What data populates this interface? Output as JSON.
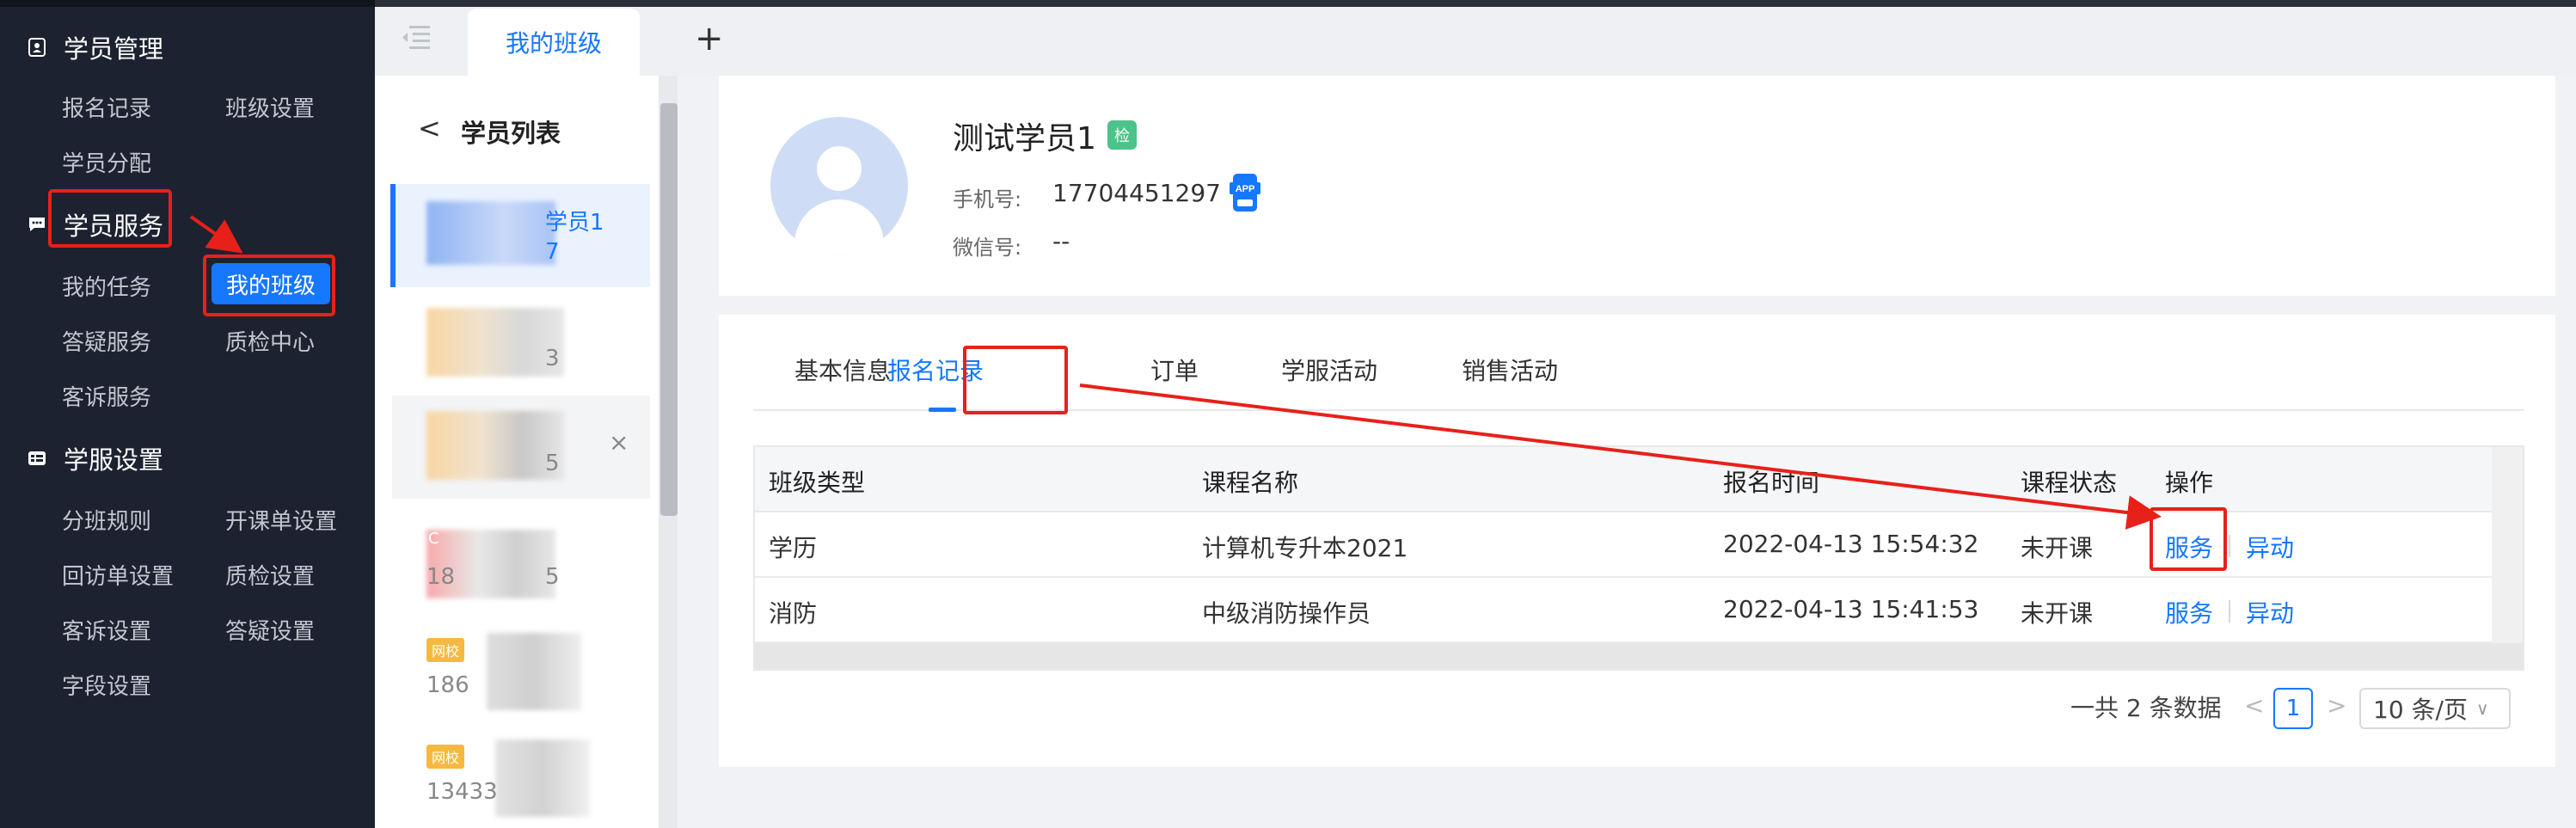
{
  "sidebar": {
    "sections": [
      {
        "label": "学员管理",
        "icon": "contact-card-icon"
      },
      {
        "label": "学员服务",
        "icon": "chat-bubble-icon"
      },
      {
        "label": "学服设置",
        "icon": "settings-card-icon"
      }
    ],
    "items": {
      "enroll_records": "报名记录",
      "class_settings": "班级设置",
      "student_assign": "学员分配",
      "my_tasks": "我的任务",
      "my_class": "我的班级",
      "qa_service": "答疑服务",
      "qc_center": "质检中心",
      "complaint_service": "客诉服务",
      "class_rules": "分班规则",
      "open_order_settings": "开课单设置",
      "revisit_settings": "回访单设置",
      "qc_settings": "质检设置",
      "complaint_settings": "客诉设置",
      "qa_settings": "答疑设置",
      "field_settings": "字段设置"
    }
  },
  "tabbar": {
    "active_tab": "我的班级",
    "add_label": "+"
  },
  "student_list": {
    "title": "学员列表",
    "back_label": "<",
    "close_label": "×",
    "students": [
      {
        "line1": "学员1",
        "line2": "7"
      },
      {
        "line1": "",
        "line2": "3"
      },
      {
        "line1": "",
        "line2": "5"
      },
      {
        "line1": "C",
        "line2": "18",
        "line2b": "5"
      },
      {
        "tag": "网校",
        "line2": "186"
      },
      {
        "tag": "网校",
        "line2": "13433"
      }
    ]
  },
  "profile": {
    "name": "测试学员1",
    "badge": "检",
    "phone_label": "手机号:",
    "phone": "17704451297",
    "app_badge": "APP",
    "wechat_label": "微信号:",
    "wechat": "--"
  },
  "records": {
    "tabs": [
      "基本信息",
      "报名记录",
      "订单",
      "学服活动",
      "销售活动"
    ],
    "active_tab_index": 1,
    "columns": [
      "班级类型",
      "课程名称",
      "报名时间",
      "课程状态",
      "操作"
    ],
    "rows": [
      {
        "type": "学历",
        "course": "计算机专升本2021",
        "time": "2022-04-13 15:54:32",
        "status": "未开课",
        "action1": "服务",
        "action2": "异动"
      },
      {
        "type": "消防",
        "course": "中级消防操作员",
        "time": "2022-04-13 15:41:53",
        "status": "未开课",
        "action1": "服务",
        "action2": "异动"
      }
    ],
    "pagination": {
      "total_text": "一共 2 条数据",
      "prev": "<",
      "current_page": "1",
      "next": ">",
      "page_size": "10 条/页"
    }
  },
  "colors": {
    "sidebar_bg": "#1d2230",
    "accent": "#1677ff",
    "annotation_red": "#e8201a"
  }
}
